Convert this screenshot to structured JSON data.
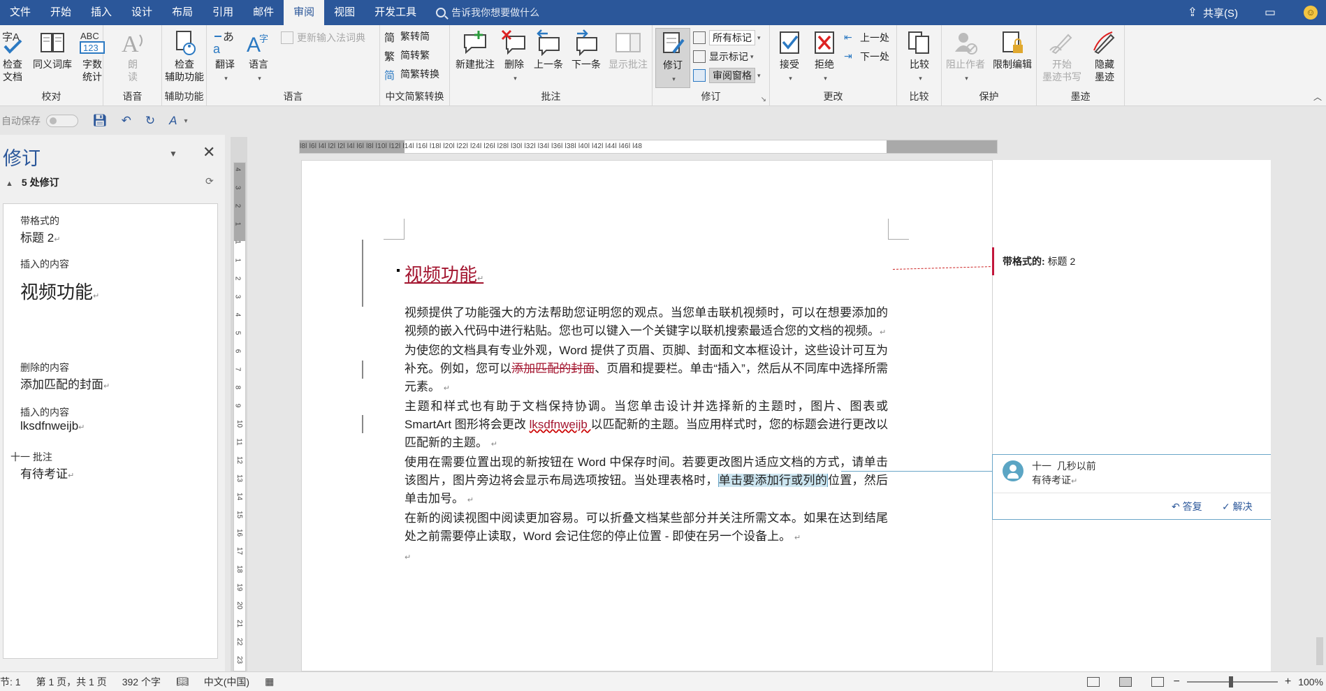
{
  "menubar": {
    "tabs": [
      "文件",
      "开始",
      "插入",
      "设计",
      "布局",
      "引用",
      "邮件",
      "审阅",
      "视图",
      "开发工具"
    ],
    "active_tab": "审阅",
    "tellme": "告诉我你想要做什么",
    "share": "共享(S)"
  },
  "ribbon": {
    "groups": {
      "proofing": "校对",
      "speech": "语音",
      "accessibility": "辅助功能",
      "language": "语言",
      "chinese_conversion": "中文简繁转换",
      "comments": "批注",
      "tracking": "修订",
      "changes": "更改",
      "compare": "比较",
      "protect": "保护",
      "ink": "墨迹"
    },
    "buttons": {
      "check_doc": "检查\n文档",
      "thesaurus": "同义词库",
      "word_count": "字数\n统计",
      "read_aloud": "朗\n读",
      "check_accessibility": "检查\n辅助功能",
      "translate": "翻译",
      "language": "语言",
      "update_ime": "更新输入法词典",
      "trad_to_simp": "繁转简",
      "simp_to_trad": "简转繁",
      "conversion": "简繁转换",
      "new_comment": "新建批注",
      "delete": "删除",
      "previous": "上一条",
      "next": "下一条",
      "show_comments": "显示批注",
      "track_changes": "修订",
      "all_markup": "所有标记",
      "show_markup": "显示标记",
      "reviewing_pane": "审阅窗格",
      "accept": "接受",
      "reject": "拒绝",
      "prev_change": "上一处",
      "next_change": "下一处",
      "compare": "比较",
      "block_authors": "阻止作者",
      "restrict_editing": "限制编辑",
      "start_inking": "开始\n墨迹书写",
      "hide_ink": "隐藏\n墨迹"
    }
  },
  "qat": {
    "autosave": "自动保存"
  },
  "revpane": {
    "title": "修订",
    "count": "5 处修订",
    "items": [
      {
        "type": "带格式的",
        "text": "标题 2"
      },
      {
        "type": "插入的内容",
        "text": "视频功能"
      },
      {
        "type": "删除的内容",
        "text": "添加匹配的封面"
      },
      {
        "type": "插入的内容",
        "text": "lksdfnweijb"
      },
      {
        "type": "十一   批注",
        "text": "有待考证"
      }
    ]
  },
  "ruler": {
    "h_numbers": "l8l  l6l  l4l  l2l     l2l  l4l  l6l  l8l  l10l  l12l  l14l  l16l  l18l  l20l  l22l  l24l  l26l  l28l  l30l  l32l  l34l  l36l  l38l  l40l  l42l  l44l  l46l  l48",
    "v_numbers": [
      "4",
      "3",
      "2",
      "1",
      "1",
      "1",
      "2",
      "3",
      "4",
      "5",
      "6",
      "7",
      "8",
      "9",
      "10",
      "11",
      "12",
      "13",
      "14",
      "15",
      "16",
      "17",
      "18",
      "19",
      "20",
      "21",
      "22",
      "23"
    ],
    "tab_selector": "L"
  },
  "document": {
    "heading": "视频功能",
    "p1": "视频提供了功能强大的方法帮助您证明您的观点。当您单击联机视频时，可以在想要添加的视频的嵌入代码中进行粘贴。您也可以键入一个关键字以联机搜索最适合您的文档的视频。",
    "p2_a": "为使您的文档具有专业外观，Word 提供了页眉、页脚、封面和文本框设计，这些设计可互为补充。例如，您可以",
    "p2_del": "添加匹配的封面",
    "p2_b": "、页眉和提要栏。单击“插入”，然后从不同库中选择所需元素。",
    "p3_a": "主题和样式也有助于文档保持协调。当您单击设计并选择新的主题时，图片、图表或 SmartArt 图形将会更改 ",
    "p3_ins": "lksdfnweijb ",
    "p3_b": "以匹配新的主题。当应用样式时，您的标题会进行更改以匹配新的主题。",
    "p4_a": "使用在需要位置出现的新按钮在 Word 中保存时间。若要更改图片适应文档的方式，请单击该图片，图片旁边将会显示布局选项按钮。当处理表格时，",
    "p4_hl": "单击要添加行或列的",
    "p4_b": "位置，然后单击加号。",
    "p5": "在新的阅读视图中阅读更加容易。可以折叠文档某些部分并关注所需文本。如果在达到结尾处之前需要停止读取，Word 会记住您的停止位置 - 即使在另一个设备上。"
  },
  "balloons": {
    "format_label": "带格式的:",
    "format_value": "标题 2",
    "comment_author": "十一",
    "comment_time": "几秒以前",
    "comment_text": "有待考证",
    "reply": "答复",
    "resolve": "解决"
  },
  "statusbar": {
    "section": "节: 1",
    "page": "第 1 页，共 1 页",
    "words": "392 个字",
    "language": "中文(中国)",
    "zoom": "100%"
  },
  "colors": {
    "brand": "#2b579a",
    "revision": "#a3152f",
    "comment": "#6aa6c8"
  }
}
